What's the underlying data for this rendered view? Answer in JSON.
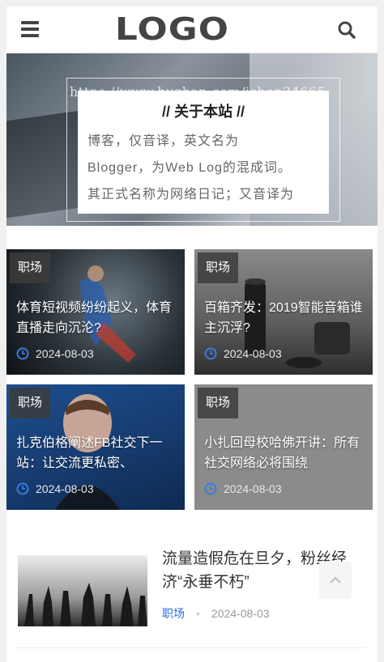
{
  "header": {
    "logo_text": "LOGO",
    "menu_icon": "menu-icon",
    "search_icon": "search-icon"
  },
  "hero": {
    "watermark": "https://www.huzhan.com/ishop34665",
    "title": "// 关于本站 //",
    "text_lines": [
      "博客，仅音译，英文名为",
      "Blogger，为Web Log的混成词。",
      "其正式名称为网络日记；又音译为"
    ]
  },
  "cards": [
    {
      "tag": "职场",
      "title": "体育短视频纷纷起义，体育直播走向沉沦?",
      "date": "2024-08-03"
    },
    {
      "tag": "职场",
      "title": "百箱齐发：2019智能音箱谁主沉浮?",
      "date": "2024-08-03"
    },
    {
      "tag": "职场",
      "title": "扎克伯格阐述FB社交下一站：让交流更私密、",
      "date": "2024-08-03"
    },
    {
      "tag": "职场",
      "title": "小扎回母校哈佛开讲：所有社交网络必将围绕",
      "date": "2024-08-03"
    }
  ],
  "list_item": {
    "title": "流量造假危在旦夕，粉丝经济“永垂不朽”",
    "category": "职场",
    "separator": "•",
    "date": "2024-08-03"
  },
  "colors": {
    "accent": "#2a6fd6",
    "tag_bg": "#3c3c3c",
    "text": "#333333"
  },
  "back_to_top_icon": "chevron-up-icon"
}
